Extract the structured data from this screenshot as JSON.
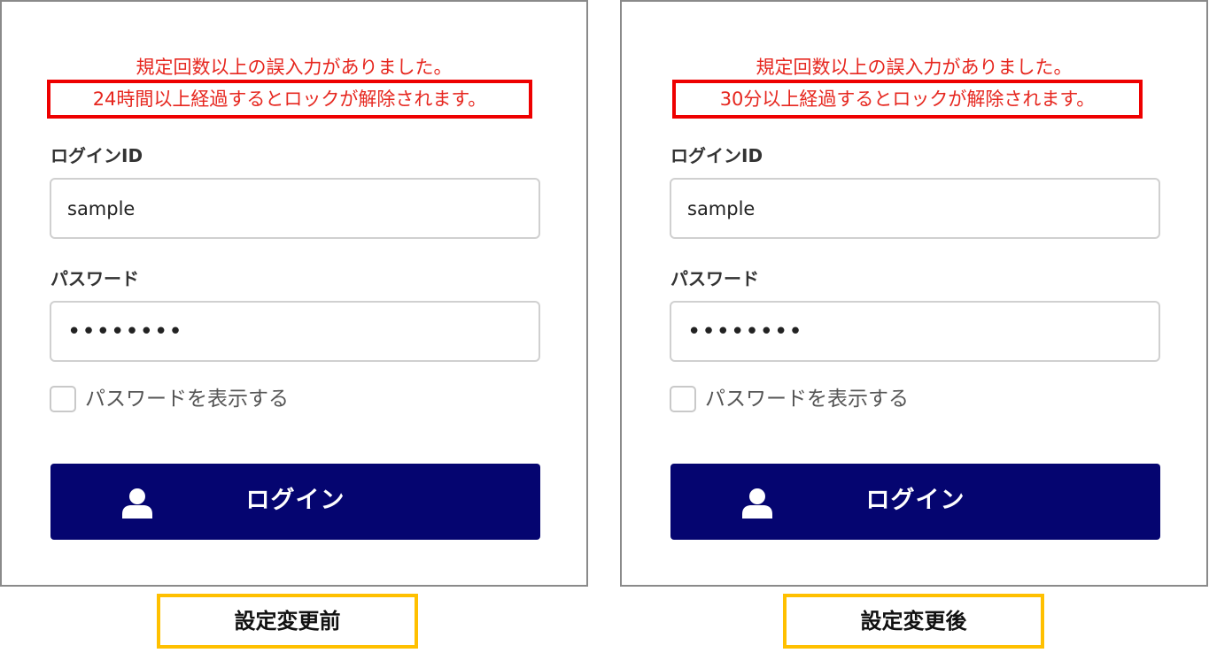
{
  "panels": [
    {
      "error_line1": "規定回数以上の誤入力がありました。",
      "error_line2": "24時間以上経過するとロックが解除されます。",
      "login_id_label": "ログインID",
      "login_id_value": "sample",
      "password_label": "パスワード",
      "password_value": "••••••••",
      "show_password_label": "パスワードを表示する",
      "show_password_checked": false,
      "login_button_label": "ログイン",
      "login_button_icon": "user-icon",
      "caption": "設定変更前"
    },
    {
      "error_line1": "規定回数以上の誤入力がありました。",
      "error_line2": "30分以上経過するとロックが解除されます。",
      "login_id_label": "ログインID",
      "login_id_value": "sample",
      "password_label": "パスワード",
      "password_value": "••••••••",
      "show_password_label": "パスワードを表示する",
      "show_password_checked": false,
      "login_button_label": "ログイン",
      "login_button_icon": "user-icon",
      "caption": "設定変更後"
    }
  ],
  "colors": {
    "error_text": "#e6271f",
    "error_highlight_border": "#ee0000",
    "button_background": "#050570",
    "caption_border": "#ffc000",
    "panel_border": "#8a8a8a"
  }
}
